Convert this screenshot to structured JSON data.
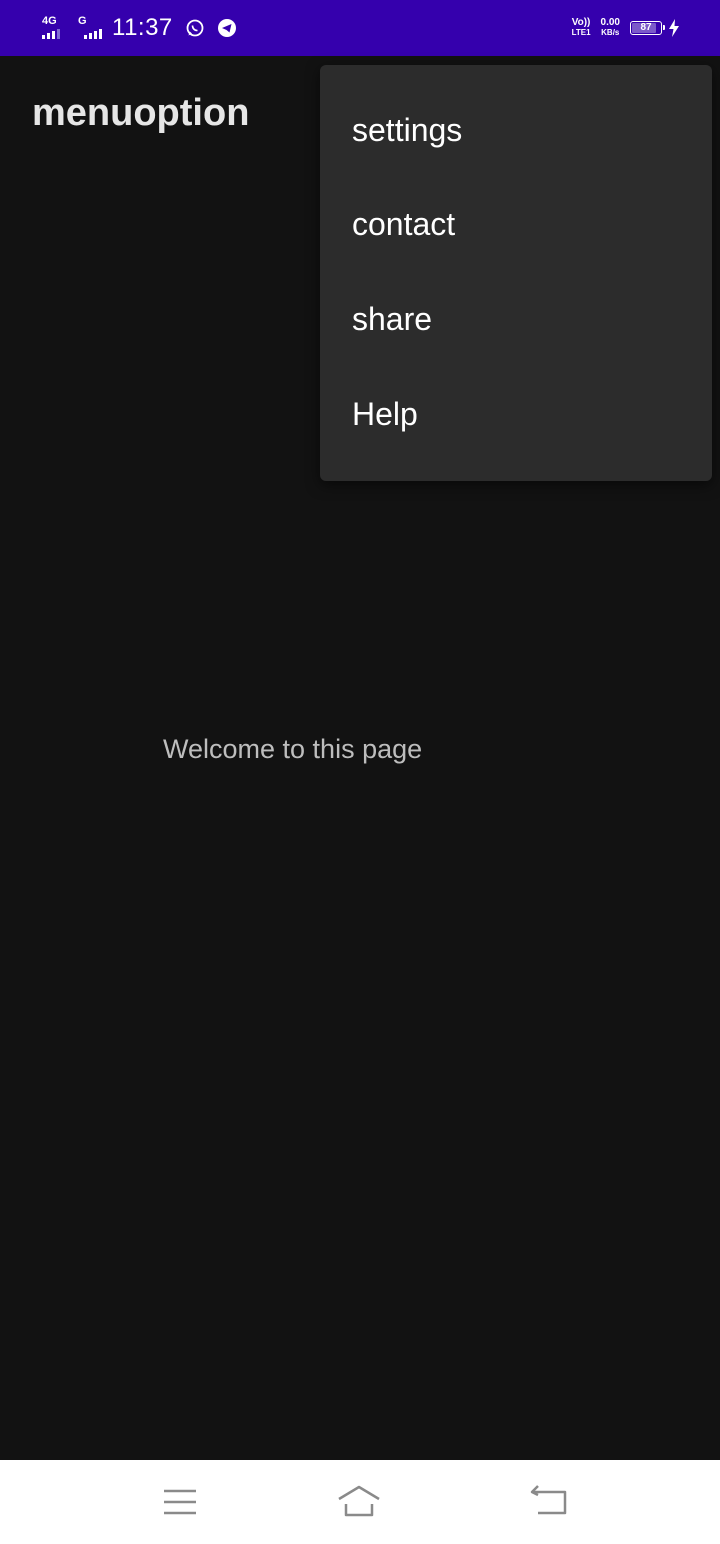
{
  "status_bar": {
    "time": "11:37",
    "sim1_network": "4G",
    "sim2_network": "G",
    "volte_top": "Vo))",
    "volte_bottom": "LTE1",
    "speed_value": "0.00",
    "speed_unit": "KB/s",
    "battery_level": "87",
    "battery_fraction": 0.87,
    "charging": true,
    "icons": [
      "whatsapp-icon",
      "telegram-icon",
      "charging-bolt-icon"
    ],
    "background_color": "#3500ad"
  },
  "app_bar": {
    "title": "menuoption"
  },
  "overflow_menu": {
    "items": [
      {
        "label": "settings"
      },
      {
        "label": "contact"
      },
      {
        "label": "share"
      },
      {
        "label": "Help"
      }
    ],
    "background_color": "#2c2c2c"
  },
  "main": {
    "message": "Welcome to this page",
    "background_color": "#121212"
  },
  "nav_bar": {
    "icons": [
      "menu-icon",
      "home-icon",
      "back-icon"
    ]
  }
}
